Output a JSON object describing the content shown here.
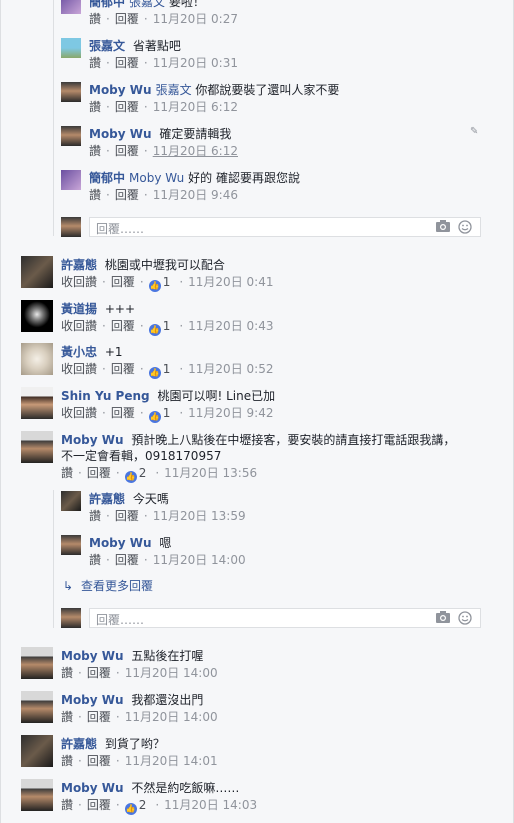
{
  "labels": {
    "like": "讚",
    "reply": "回覆",
    "unlike": "收回讚",
    "reply_placeholder": "回覆……",
    "view_more": "查看更多回覆"
  },
  "nested_top": [
    {
      "name": "簡郁中",
      "mention": "張嘉文",
      "text": "要啦！",
      "time": "11月20日 0:27",
      "like_label": "讚"
    },
    {
      "name": "張嘉文",
      "mention": "",
      "text": "省著點吧",
      "time": "11月20日 0:31",
      "like_label": "讚"
    },
    {
      "name": "Moby Wu",
      "mention": "張嘉文",
      "text": "你都說要裝了還叫人家不要",
      "time": "11月20日 6:12",
      "like_label": "讚"
    },
    {
      "name": "Moby Wu",
      "mention": "",
      "text": "確定要請輯我",
      "time": "11月20日 6:12",
      "like_label": "讚"
    },
    {
      "name": "簡郁中",
      "mention": "Moby Wu",
      "text": "好的 確認要再跟您說",
      "time": "11月20日 9:46",
      "like_label": "讚"
    }
  ],
  "top_level": [
    {
      "name": "許嘉態",
      "text": "桃園或中壢我可以配合",
      "like_label": "收回讚",
      "likes": "1",
      "time": "11月20日 0:41"
    },
    {
      "name": "黃道揚",
      "text": "+++",
      "like_label": "收回讚",
      "likes": "1",
      "time": "11月20日 0:43"
    },
    {
      "name": "黃小忠",
      "text": "+1",
      "like_label": "收回讚",
      "likes": "1",
      "time": "11月20日 0:52"
    },
    {
      "name": "Shin Yu Peng",
      "text": "桃園可以啊! Line已加",
      "like_label": "收回讚",
      "likes": "1",
      "time": "11月20日 9:42"
    },
    {
      "name": "Moby Wu",
      "text_line1": "預計晚上八點後在中壢接客，要安裝的請直接打電話跟我講，",
      "text_line2": "不一定會看輯，0918170957",
      "like_label": "讚",
      "likes": "2",
      "time": "11月20日 13:56"
    }
  ],
  "nested_mid": [
    {
      "name": "許嘉態",
      "text": "今天嗎",
      "time": "11月20日 13:59",
      "like_label": "讚"
    },
    {
      "name": "Moby Wu",
      "text": "嗯",
      "time": "11月20日 14:00",
      "like_label": "讚"
    }
  ],
  "bottom": [
    {
      "name": "Moby Wu",
      "text": "五點後在打喔",
      "time": "11月20日 14:00",
      "like_label": "讚",
      "likes": ""
    },
    {
      "name": "Moby Wu",
      "text": "我都還沒出門",
      "time": "11月20日 14:00",
      "like_label": "讚",
      "likes": ""
    },
    {
      "name": "許嘉態",
      "text": "到貨了哟？",
      "time": "11月20日 14:01",
      "like_label": "讚",
      "likes": ""
    },
    {
      "name": "Moby Wu",
      "text": "不然是約吃飯嘛……",
      "time": "11月20日 14:03",
      "like_label": "讚",
      "likes": "2"
    }
  ]
}
